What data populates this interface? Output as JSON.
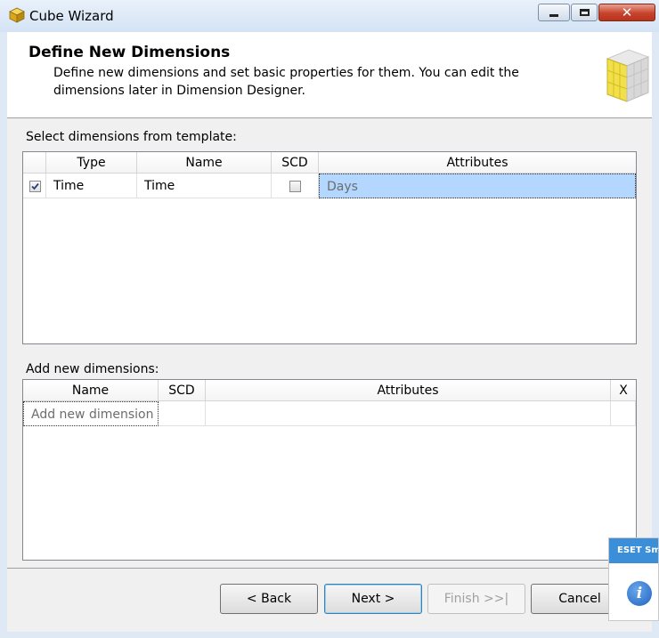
{
  "window": {
    "title": "Cube Wizard"
  },
  "header": {
    "title": "Define New Dimensions",
    "description": "Define new dimensions and set basic properties for them. You can edit the dimensions later in Dimension Designer."
  },
  "template_section": {
    "label": "Select dimensions from template:",
    "columns": [
      "Type",
      "Name",
      "SCD",
      "Attributes"
    ],
    "rows": [
      {
        "checked": true,
        "type": "Time",
        "name": "Time",
        "scd": false,
        "attributes": "Days"
      }
    ]
  },
  "new_section": {
    "label": "Add new dimensions:",
    "columns": [
      "Name",
      "SCD",
      "Attributes",
      "X"
    ],
    "placeholder": "Add new dimension"
  },
  "buttons": {
    "back": "< Back",
    "next": "Next >",
    "finish": "Finish >>|",
    "cancel": "Cancel"
  },
  "notification": {
    "title": "ESET Smart",
    "icon": "info-icon"
  },
  "colors": {
    "selection": "#b3d7ff",
    "accent": "#3a8fd8"
  }
}
